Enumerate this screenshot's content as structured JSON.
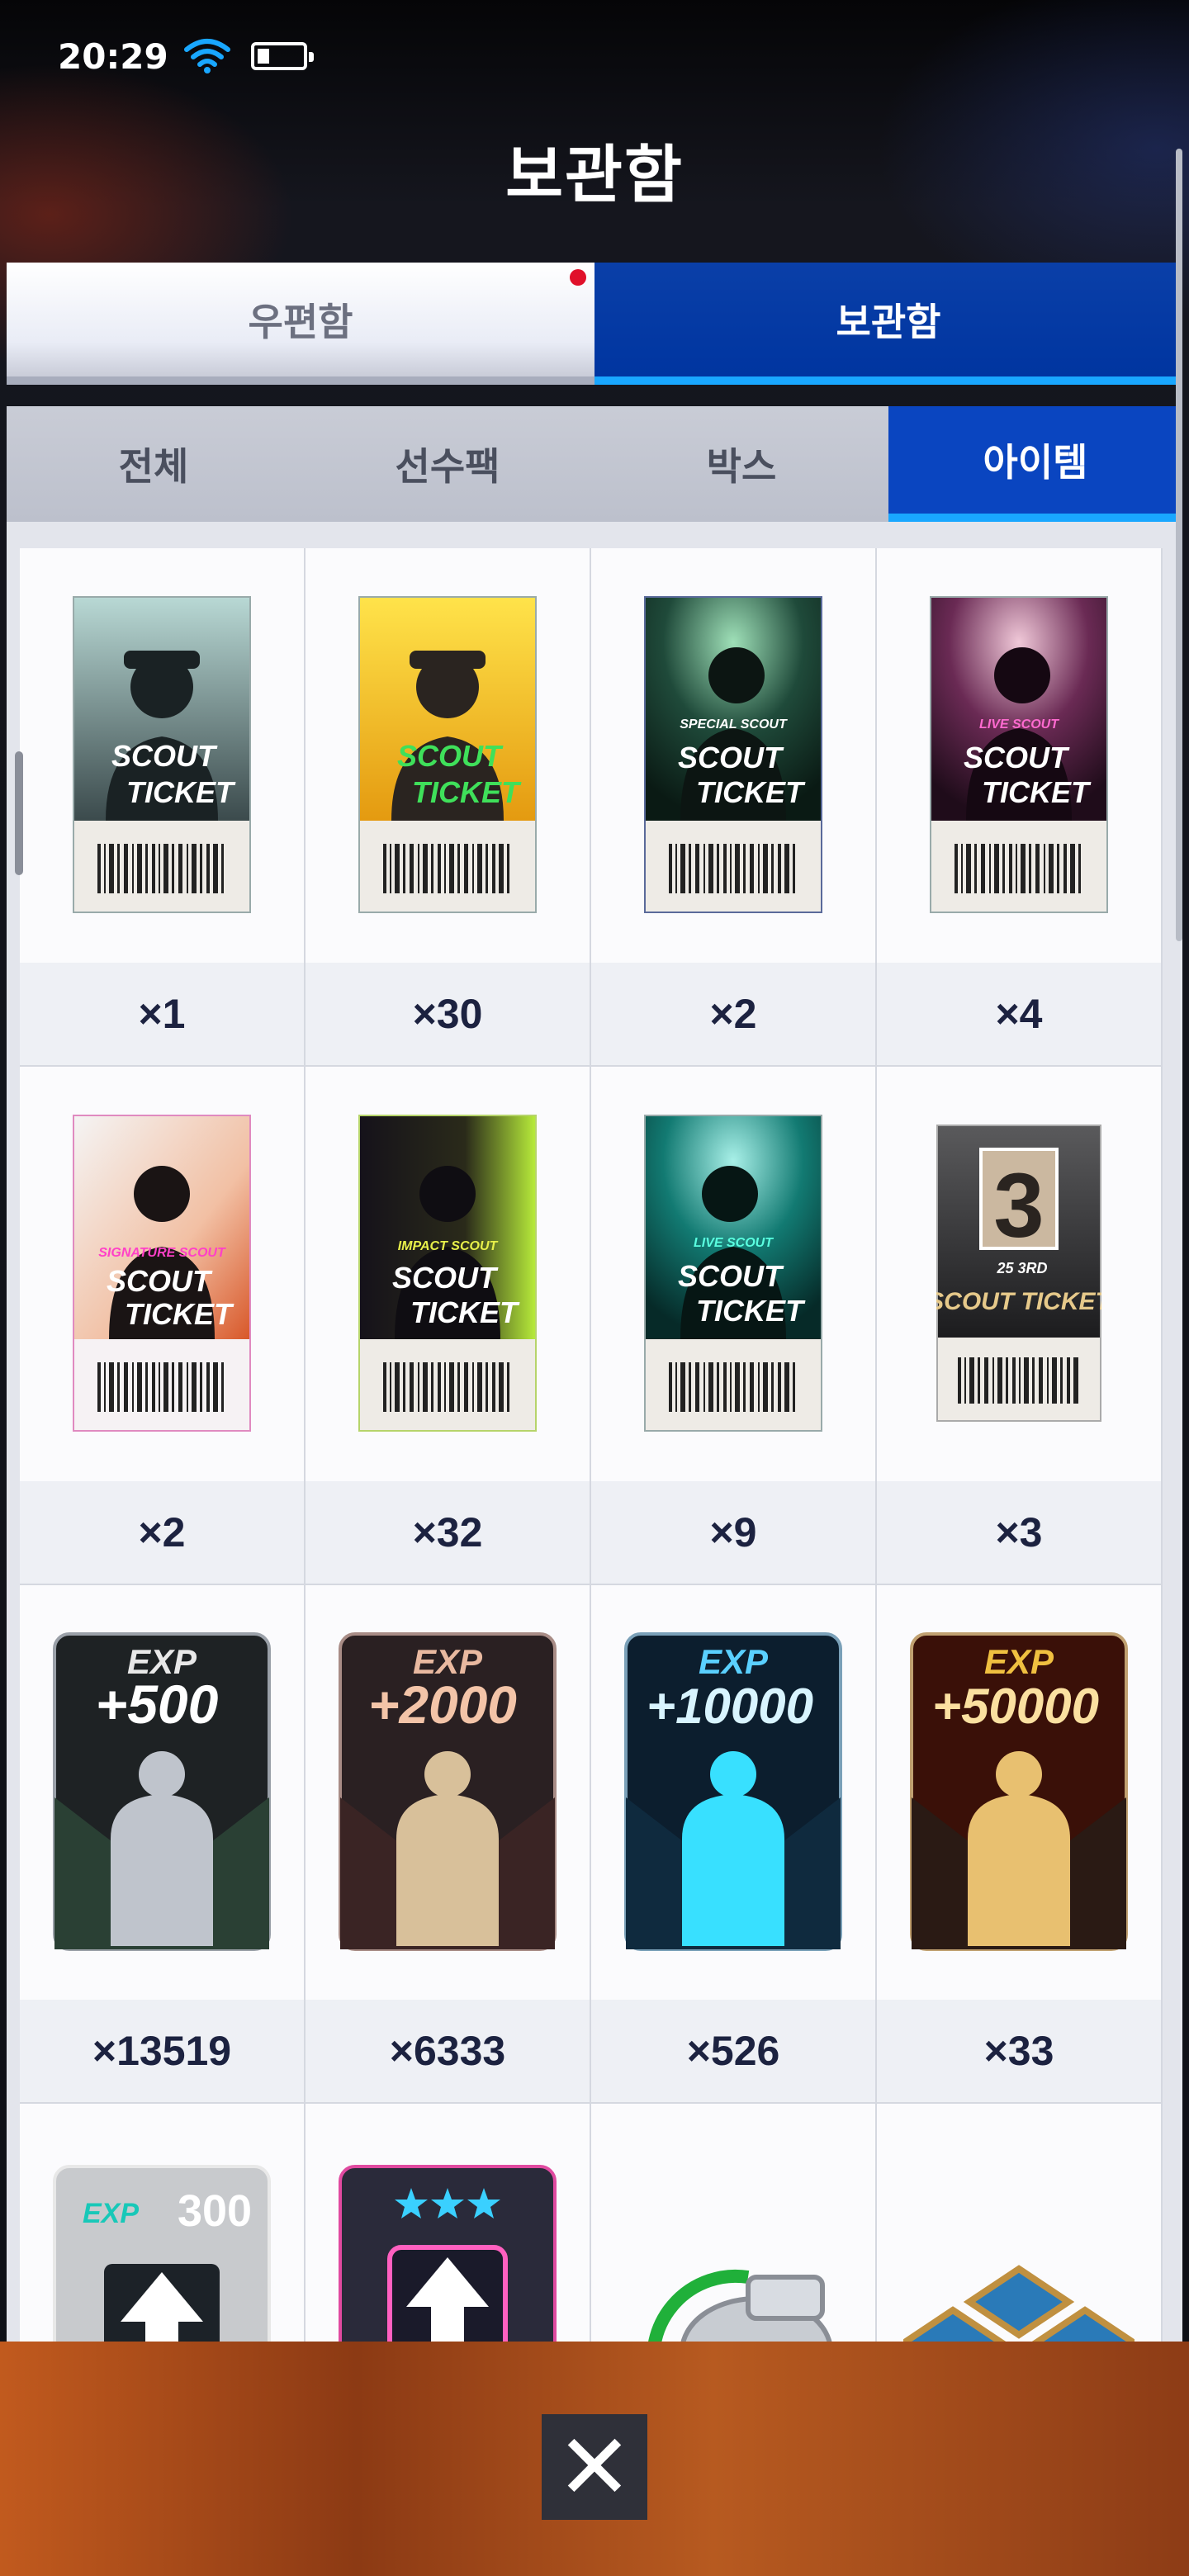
{
  "status_bar": {
    "time": "20:29"
  },
  "header": {
    "title": "보관함"
  },
  "top_tabs": [
    {
      "label": "우편함",
      "active": false,
      "has_notification": true
    },
    {
      "label": "보관함",
      "active": true
    }
  ],
  "sub_tabs": [
    {
      "label": "전체",
      "active": false
    },
    {
      "label": "선수팩",
      "active": false
    },
    {
      "label": "박스",
      "active": false
    },
    {
      "label": "아이템",
      "active": true
    }
  ],
  "items": [
    {
      "icon": "scout-ticket-icon",
      "title": "SCOUT",
      "title2": "TICKET",
      "tag": "",
      "quantity": "×1"
    },
    {
      "icon": "scout-ticket-gold-icon",
      "title": "SCOUT",
      "title2": "TICKET",
      "tag": "",
      "quantity": "×30"
    },
    {
      "icon": "special-scout-ticket-icon",
      "title": "SCOUT",
      "title2": "TICKET",
      "tag": "SPECIAL SCOUT",
      "quantity": "×2"
    },
    {
      "icon": "live-scout-ticket-icon",
      "title": "SCOUT",
      "title2": "TICKET",
      "tag": "LIVE SCOUT",
      "quantity": "×4"
    },
    {
      "icon": "signature-scout-ticket-icon",
      "title": "SCOUT",
      "title2": "TICKET",
      "tag": "SIGNATURE SCOUT",
      "quantity": "×2"
    },
    {
      "icon": "impact-scout-ticket-icon",
      "title": "SCOUT",
      "title2": "TICKET",
      "tag": "IMPACT SCOUT",
      "quantity": "×32"
    },
    {
      "icon": "live-scout-ticket-teal-icon",
      "title": "SCOUT",
      "title2": "TICKET",
      "tag": "LIVE SCOUT",
      "quantity": "×9"
    },
    {
      "icon": "anniversary-scout-ticket-icon",
      "title": "SCOUT TICKET",
      "badge": "3",
      "tag": "25 3RD",
      "quantity": "×3"
    },
    {
      "icon": "exp-card-500-icon",
      "label": "EXP",
      "amount": "+500",
      "quantity": "×13519"
    },
    {
      "icon": "exp-card-2000-icon",
      "label": "EXP",
      "amount": "+2000",
      "quantity": "×6333"
    },
    {
      "icon": "exp-card-10000-icon",
      "label": "EXP",
      "amount": "+10000",
      "quantity": "×526"
    },
    {
      "icon": "exp-card-50000-icon",
      "label": "EXP",
      "amount": "+50000",
      "quantity": "×33"
    },
    {
      "icon": "exp-300-upgrade-icon",
      "label": "EXP",
      "amount": "300",
      "quantity": ""
    },
    {
      "icon": "star-upgrade-icon",
      "label": "",
      "amount": "",
      "quantity": ""
    },
    {
      "icon": "whistle-icon",
      "label": "",
      "amount": "",
      "quantity": ""
    },
    {
      "icon": "cube-boxes-icon",
      "label": "",
      "amount": "",
      "quantity": ""
    }
  ],
  "colors": {
    "accent": "#0a45c0",
    "accent_bar": "#19a7ff",
    "notification": "#e0102a"
  }
}
